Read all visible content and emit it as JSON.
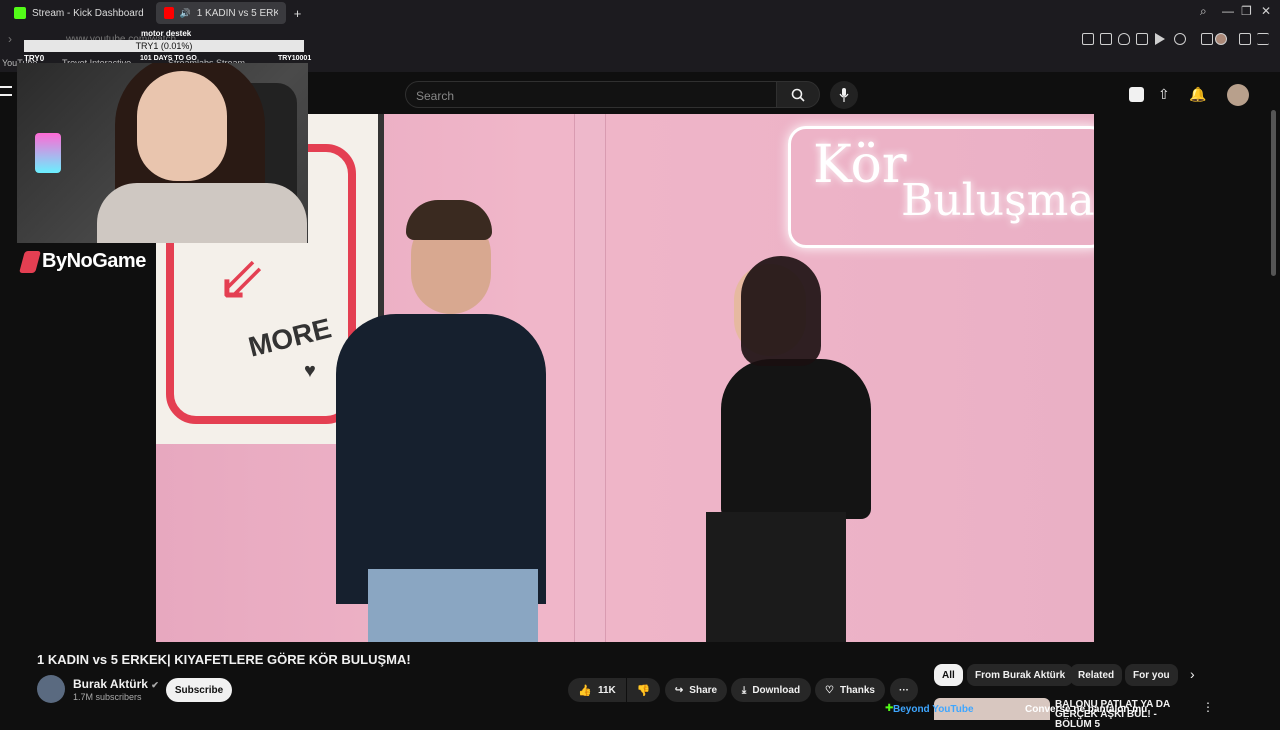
{
  "browser": {
    "tabs": [
      {
        "label": "Stream - Kick Dashboard",
        "active": false
      },
      {
        "label": "1 KADIN vs 5 ERKEK|",
        "active": true
      }
    ],
    "new_tab": "+",
    "url": "www.youtube.com/watch",
    "bookmarks": [
      "YouTube",
      "Trevet Interactive",
      "Streamlabs Stream"
    ]
  },
  "overlay": {
    "top_label": "motor destek",
    "progress_label": "TRY1 (0.01%)",
    "left_value": "TRY0",
    "middle_value": "101 DAYS TO GO",
    "right_value": "TRY10001",
    "sponsor": "ByNoGame"
  },
  "youtube": {
    "search_placeholder": "Search",
    "video_sign_text": "MORE",
    "neon_line1": "Kör",
    "neon_line2": "Buluşma",
    "title": "1 KADIN vs 5 ERKEK| KIYAFETLERE GÖRE KÖR BULUŞMA!",
    "channel": "Burak Aktürk",
    "subscribers": "1.7M subscribers",
    "subscribe_label": "Subscribe",
    "likes": "11K",
    "share_label": "Share",
    "download_label": "Download",
    "thanks_label": "Thanks",
    "more_label": "···",
    "chips": [
      "All",
      "From Burak Aktürk",
      "Related",
      "For you"
    ],
    "rec_title": "BALONU PATLAT YA DA GERÇEK AŞKI BUL! - BÖLÜM 5",
    "ticker_blue": "Beyond YouTube",
    "ticker_white": "Converse ne pantalon mu"
  },
  "colors": {
    "bg": "#0f0f0f",
    "accent_red": "#e43f52",
    "kick_green": "#53fc18",
    "youtube_red": "#ff0000"
  }
}
